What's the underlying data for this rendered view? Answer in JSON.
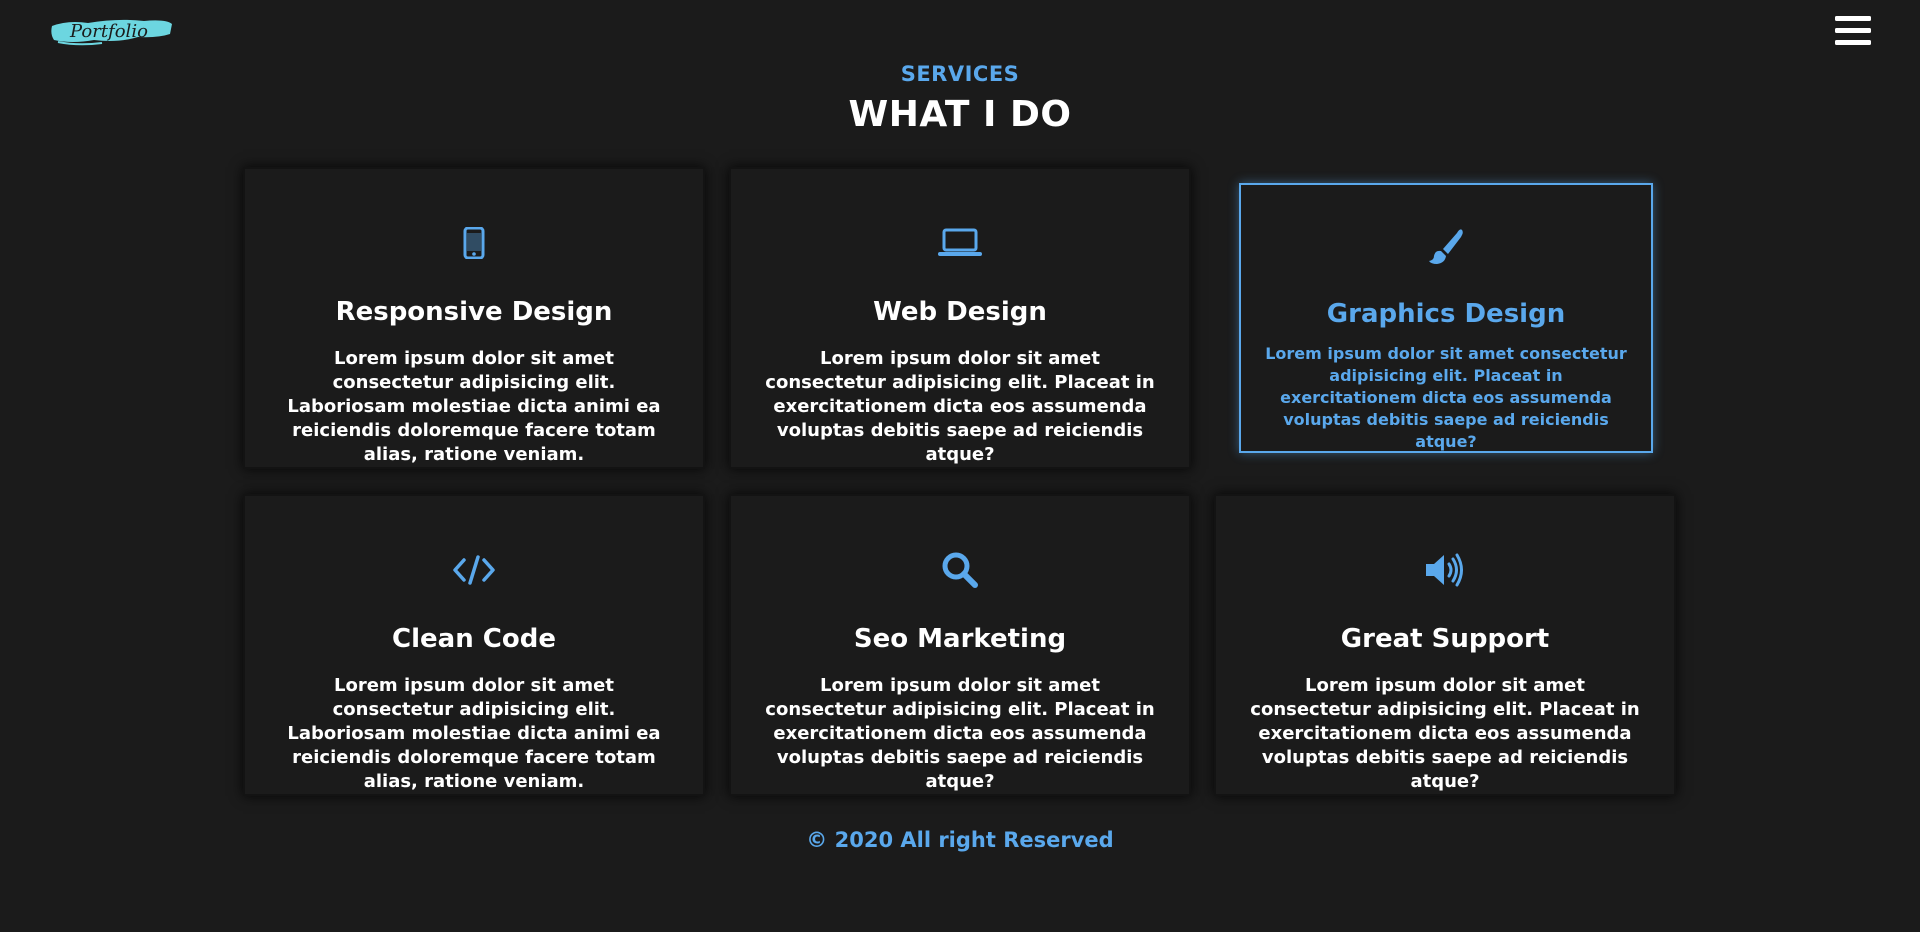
{
  "header": {
    "logo_text": "Portfolio",
    "menu_icon": "hamburger-menu-icon"
  },
  "section": {
    "eyebrow": "SERVICES",
    "heading": "WHAT I DO"
  },
  "colors": {
    "accent": "#5aa8ec",
    "background": "#1b1b1b",
    "text": "#ffffff"
  },
  "services": [
    {
      "icon": "mobile-phone-icon",
      "title": "Responsive Design",
      "description": "Lorem ipsum dolor sit amet consectetur adipisicing elit. Laboriosam molestiae dicta animi ea reiciendis doloremque facere totam alias, ratione veniam."
    },
    {
      "icon": "laptop-icon",
      "title": "Web Design",
      "description": "Lorem ipsum dolor sit amet consectetur adipisicing elit. Placeat in exercitationem dicta eos assumenda voluptas debitis saepe ad reiciendis atque?"
    },
    {
      "icon": "paint-brush-icon",
      "title": "Graphics Design",
      "description": "Lorem ipsum dolor sit amet consectetur adipisicing elit. Placeat in exercitationem dicta eos assumenda voluptas debitis saepe ad reiciendis atque?"
    },
    {
      "icon": "code-icon",
      "title": "Clean Code",
      "description": "Lorem ipsum dolor sit amet consectetur adipisicing elit. Laboriosam molestiae dicta animi ea reiciendis doloremque facere totam alias, ratione veniam."
    },
    {
      "icon": "search-icon",
      "title": "Seo Marketing",
      "description": "Lorem ipsum dolor sit amet consectetur adipisicing elit. Placeat in exercitationem dicta eos assumenda voluptas debitis saepe ad reiciendis atque?"
    },
    {
      "icon": "volume-up-icon",
      "title": "Great Support",
      "description": "Lorem ipsum dolor sit amet consectetur adipisicing elit. Placeat in exercitationem dicta eos assumenda voluptas debitis saepe ad reiciendis atque?"
    }
  ],
  "footer": {
    "text": "© 2020 All right Reserved"
  }
}
